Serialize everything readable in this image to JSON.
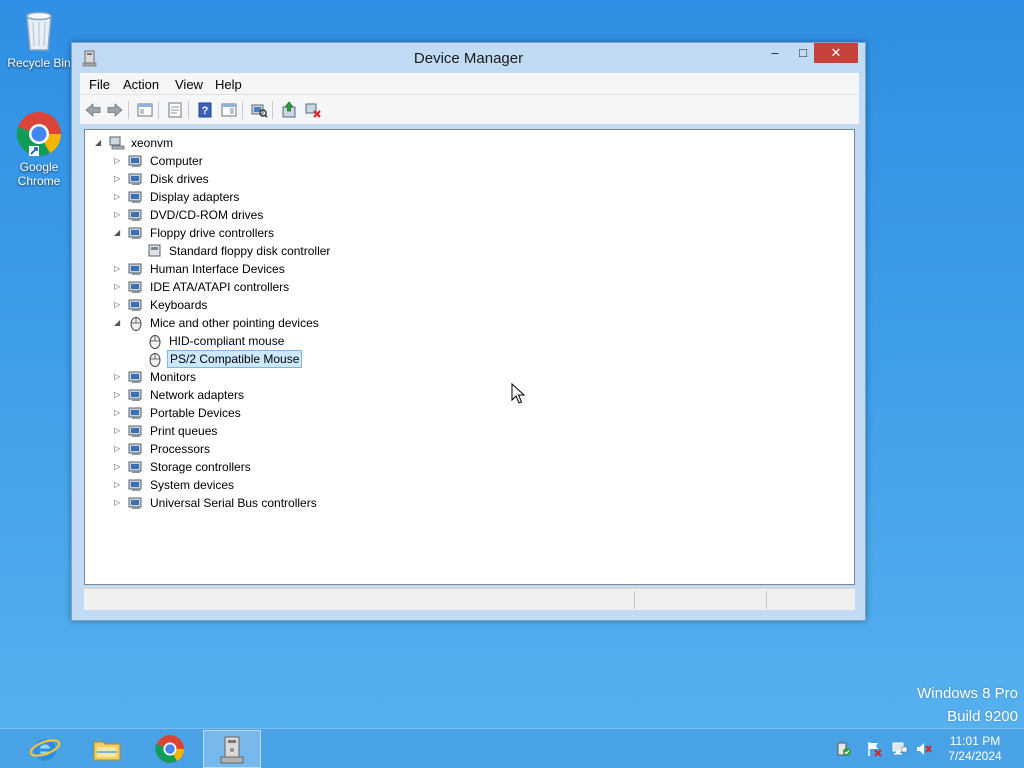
{
  "desktop": {
    "icons": [
      {
        "label": "Recycle Bin"
      },
      {
        "label": "Google Chrome"
      }
    ],
    "watermark": {
      "line1": "Windows 8 Pro",
      "line2": "Build 9200"
    }
  },
  "window": {
    "title": "Device Manager",
    "controls": {
      "minimize": "–",
      "maximize": "□",
      "close": "✕"
    },
    "menu": [
      "File",
      "Action",
      "View",
      "Help"
    ],
    "tree": {
      "root": "xeonvm",
      "items": [
        {
          "label": "Computer",
          "expanded": false
        },
        {
          "label": "Disk drives",
          "expanded": false
        },
        {
          "label": "Display adapters",
          "expanded": false
        },
        {
          "label": "DVD/CD-ROM drives",
          "expanded": false
        },
        {
          "label": "Floppy drive controllers",
          "expanded": true,
          "children": [
            "Standard floppy disk controller"
          ]
        },
        {
          "label": "Human Interface Devices",
          "expanded": false
        },
        {
          "label": "IDE ATA/ATAPI controllers",
          "expanded": false
        },
        {
          "label": "Keyboards",
          "expanded": false
        },
        {
          "label": "Mice and other pointing devices",
          "expanded": true,
          "children": [
            "HID-compliant mouse",
            "PS/2 Compatible Mouse"
          ]
        },
        {
          "label": "Monitors",
          "expanded": false
        },
        {
          "label": "Network adapters",
          "expanded": false
        },
        {
          "label": "Portable Devices",
          "expanded": false
        },
        {
          "label": "Print queues",
          "expanded": false
        },
        {
          "label": "Processors",
          "expanded": false
        },
        {
          "label": "Storage controllers",
          "expanded": false
        },
        {
          "label": "System devices",
          "expanded": false
        },
        {
          "label": "Universal Serial Bus controllers",
          "expanded": false
        }
      ],
      "selected": "PS/2 Compatible Mouse"
    }
  },
  "taskbar": {
    "apps": [
      "internet-explorer",
      "file-explorer",
      "google-chrome",
      "device-manager"
    ],
    "clock": {
      "time": "11:01 PM",
      "date": "7/24/2024"
    }
  },
  "colors": {
    "accent": "#3c9ae8",
    "close": "#c7403a",
    "selection": "#cce8ff"
  }
}
